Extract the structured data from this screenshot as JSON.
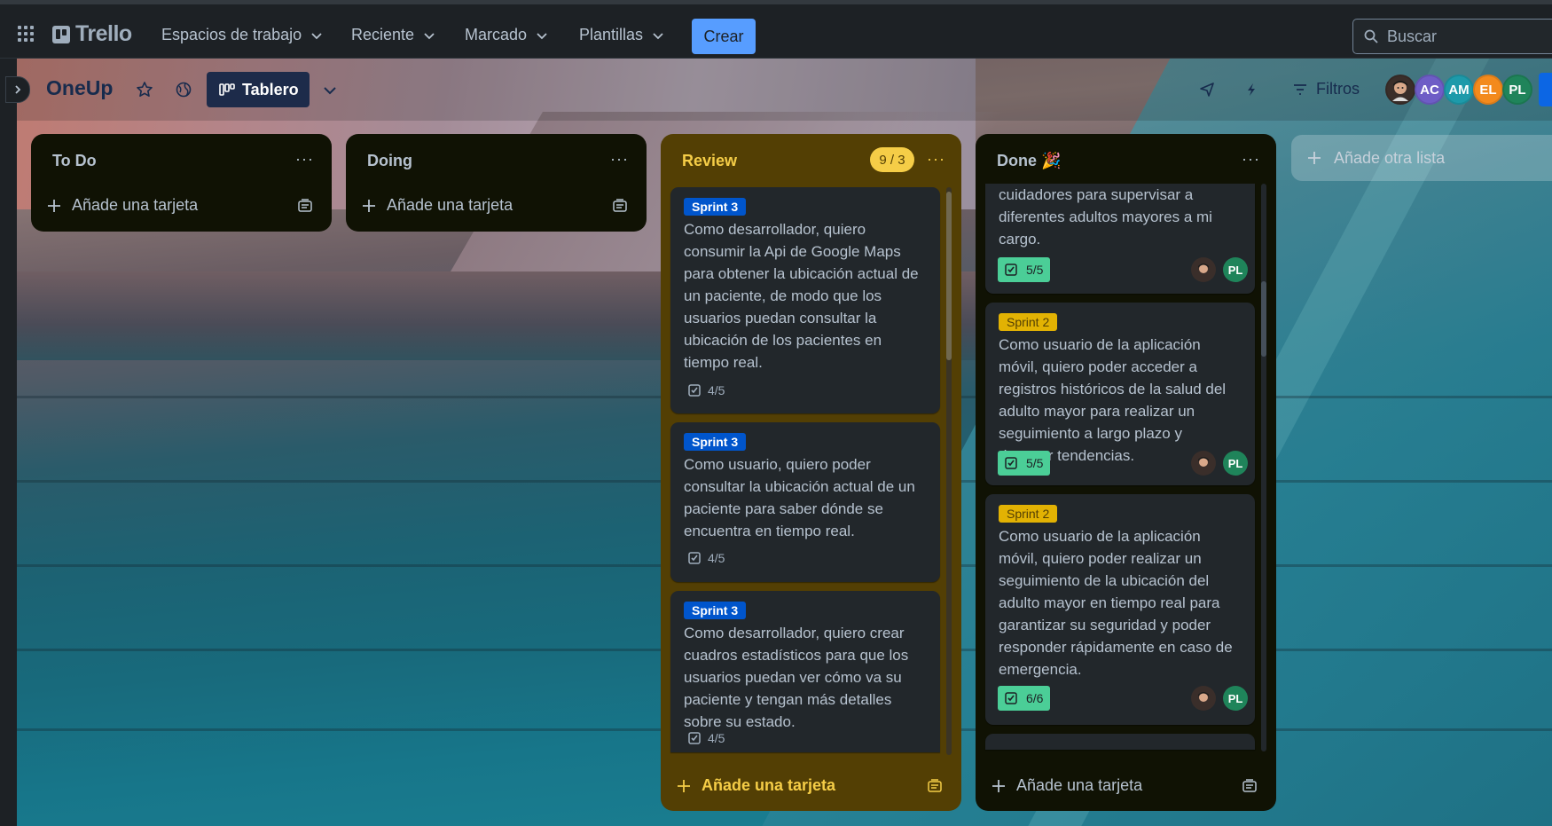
{
  "topbar": {
    "logo": "Trello",
    "nav": [
      "Espacios de trabajo",
      "Reciente",
      "Marcado",
      "Plantillas"
    ],
    "create_label": "Crear",
    "search_placeholder": "Buscar"
  },
  "board": {
    "title": "OneUp",
    "view_label": "Tablero",
    "filter_label": "Filtros",
    "members": [
      {
        "initials": "",
        "color": "#3a2e2a"
      },
      {
        "initials": "AC",
        "color": "#6e5dc6"
      },
      {
        "initials": "AM",
        "color": "#1d9aaa"
      },
      {
        "initials": "EL",
        "color": "#f38a1c"
      },
      {
        "initials": "PL",
        "color": "#1f845a"
      }
    ],
    "add_list_label": "Añade otra lista"
  },
  "lists": {
    "todo": {
      "title": "To Do",
      "add_label": "Añade una tarjeta"
    },
    "doing": {
      "title": "Doing",
      "add_label": "Añade una tarjeta"
    },
    "review": {
      "title": "Review",
      "wip": "9 / 3",
      "add_label": "Añade una tarjeta",
      "cards": [
        {
          "label": "Sprint 3",
          "text": [
            "Como desarrollador, quiero",
            "consumir la Api de Google Maps",
            "para obtener la ubicación actual de",
            "un paciente, de modo que los",
            "usuarios puedan consultar la",
            "ubicación de los pacientes en",
            "tiempo real."
          ],
          "checklist": "4/5"
        },
        {
          "label": "Sprint 3",
          "text": [
            "Como usuario, quiero poder",
            "consultar la ubicación actual de un",
            "paciente para saber dónde se",
            "encuentra en tiempo real."
          ],
          "checklist": "4/5"
        },
        {
          "label": "Sprint 3",
          "text": [
            "Como desarrollador, quiero crear",
            "cuadros estadísticos para que los",
            "usuarios puedan ver cómo va su",
            "paciente y tengan más detalles",
            "sobre su estado."
          ],
          "checklist": "4/5"
        }
      ]
    },
    "done": {
      "title": "Done 🎉",
      "add_label": "Añade una tarjeta",
      "cards": [
        {
          "label": "",
          "text": [
            "cuidadores para supervisar a",
            "diferentes adultos mayores a mi",
            "cargo."
          ],
          "checklist": "5/5",
          "member": "PL"
        },
        {
          "label": "Sprint 2",
          "text": [
            "Como usuario de la aplicación",
            "móvil, quiero poder acceder a",
            "registros históricos de la salud del",
            "adulto mayor para realizar un",
            "seguimiento a largo plazo y",
            "detectar tendencias."
          ],
          "checklist": "5/5",
          "member": "PL"
        },
        {
          "label": "Sprint 2",
          "text": [
            "Como usuario de la aplicación",
            "móvil, quiero poder realizar un",
            "seguimiento de la ubicación del",
            "adulto mayor en tiempo real para",
            "garantizar su seguridad y poder",
            "responder rápidamente en caso de",
            "emergencia."
          ],
          "checklist": "6/6",
          "member": "PL"
        }
      ]
    }
  }
}
